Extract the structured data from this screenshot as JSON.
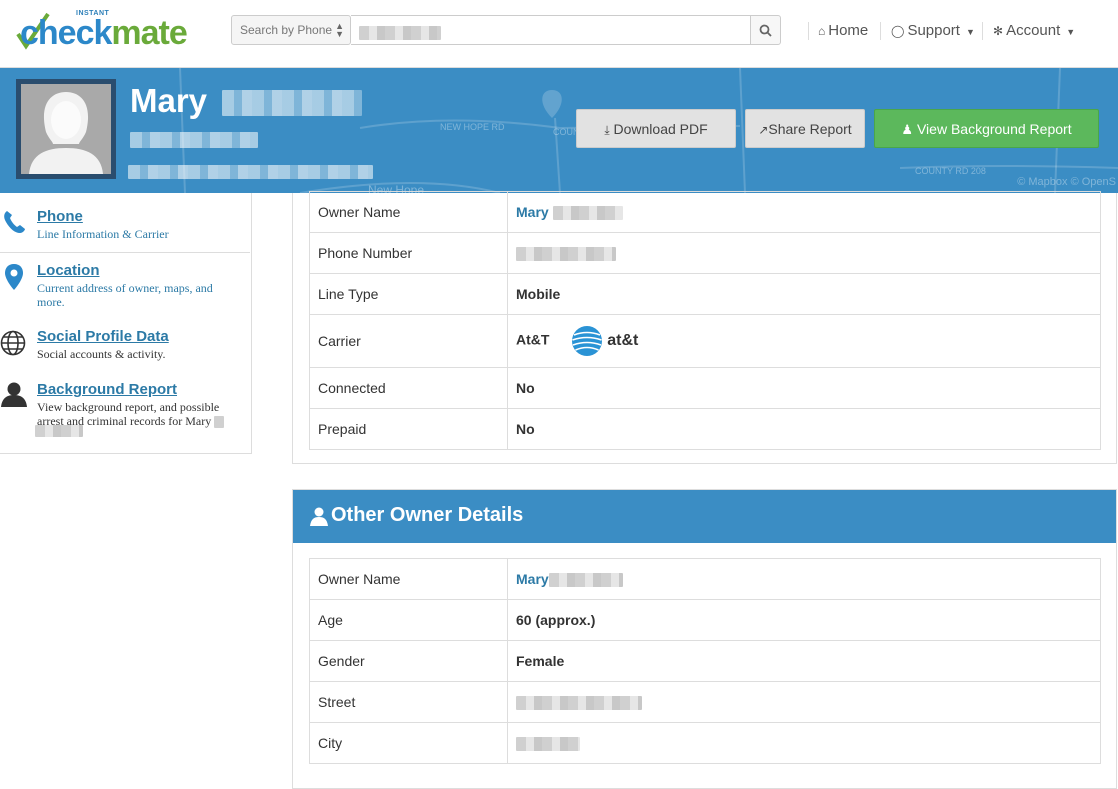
{
  "brand": {
    "instant": "INSTANT",
    "check": "check",
    "mate": "mate"
  },
  "search": {
    "type_label": "Search by Phone"
  },
  "nav": {
    "home": "Home",
    "support": "Support",
    "account": "Account"
  },
  "hero": {
    "first_name": "Mary",
    "buttons": {
      "download": "Download PDF",
      "share": "Share Report",
      "background": "View Background Report"
    },
    "map_labels": {
      "road1": "NEW HOPE RD",
      "road2": "COUNTY R",
      "road3": "COUNTY RD 208",
      "place": "New Hope",
      "attribution": "© Mapbox © OpenS"
    }
  },
  "sidebar": {
    "items": [
      {
        "title": "Phone",
        "desc": "Line Information & Carrier",
        "icon": "phone-icon"
      },
      {
        "title": "Location",
        "desc": "Current address of owner, maps, and more.",
        "icon": "map-marker-icon"
      },
      {
        "title": "Social Profile Data",
        "desc": "Social accounts & activity.",
        "icon": "globe-icon"
      },
      {
        "title": "Background Report",
        "desc_line1": "View background report, and possible",
        "desc_line2": "arrest and criminal records for Mary",
        "icon": "user-icon"
      }
    ]
  },
  "phone_details": {
    "rows": [
      {
        "label": "Owner Name",
        "value": "Mary"
      },
      {
        "label": "Phone Number",
        "value": ""
      },
      {
        "label": "Line Type",
        "value": "Mobile"
      },
      {
        "label": "Carrier",
        "value": "At&T",
        "logo_text": "at&t"
      },
      {
        "label": "Connected",
        "value": "No"
      },
      {
        "label": "Prepaid",
        "value": "No"
      }
    ]
  },
  "other_owner": {
    "title": "Other Owner Details",
    "rows": [
      {
        "label": "Owner Name",
        "value": "Mary"
      },
      {
        "label": "Age",
        "value": "60 (approx.)"
      },
      {
        "label": "Gender",
        "value": "Female"
      },
      {
        "label": "Street",
        "value": ""
      },
      {
        "label": "City",
        "value": ""
      }
    ]
  },
  "colors": {
    "primary": "#3b8dc4",
    "green": "#5cb85c",
    "link": "#2c7aa6"
  }
}
